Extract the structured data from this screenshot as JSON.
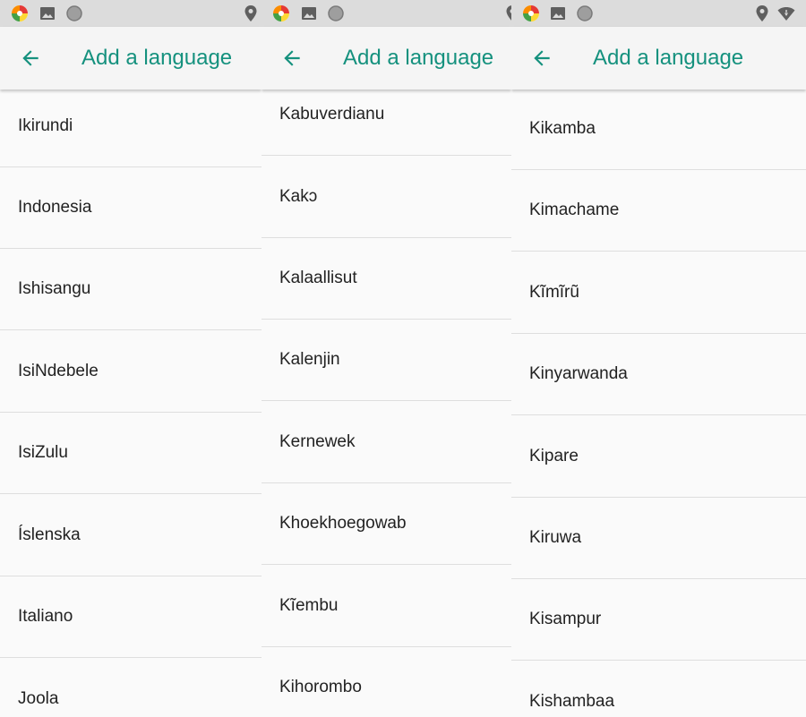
{
  "colors": {
    "accent": "#15917e",
    "statusbar": "#dcdcdc",
    "appbar": "#f5f5f5",
    "background": "#fafafa",
    "divider": "#dedede"
  },
  "panels": [
    {
      "title": "Add a language",
      "status_icons": [
        "app-colorful-icon",
        "image-icon",
        "circle-icon",
        "location-icon"
      ],
      "items": [
        "Ikirundi",
        "Indonesia",
        "Ishisangu",
        "IsiNdebele",
        "IsiZulu",
        "Íslenska",
        "Italiano",
        "Joola"
      ]
    },
    {
      "title": "Add a language",
      "status_icons": [
        "app-colorful-icon",
        "image-icon",
        "circle-icon",
        "location-icon"
      ],
      "items": [
        "Kabuverdianu",
        "Kakɔ",
        "Kalaallisut",
        "Kalenjin",
        "Kernewek",
        "Khoekhoegowab",
        "Kĩembu",
        "Kihorombo"
      ]
    },
    {
      "title": "Add a language",
      "status_icons": [
        "app-colorful-icon",
        "image-icon",
        "circle-icon",
        "location-icon",
        "wifi-icon"
      ],
      "items": [
        "Kikamba",
        "Kimachame",
        "Kĩmĩrũ",
        "Kinyarwanda",
        "Kipare",
        "Kiruwa",
        "Kisampur",
        "Kishambaa"
      ]
    }
  ]
}
